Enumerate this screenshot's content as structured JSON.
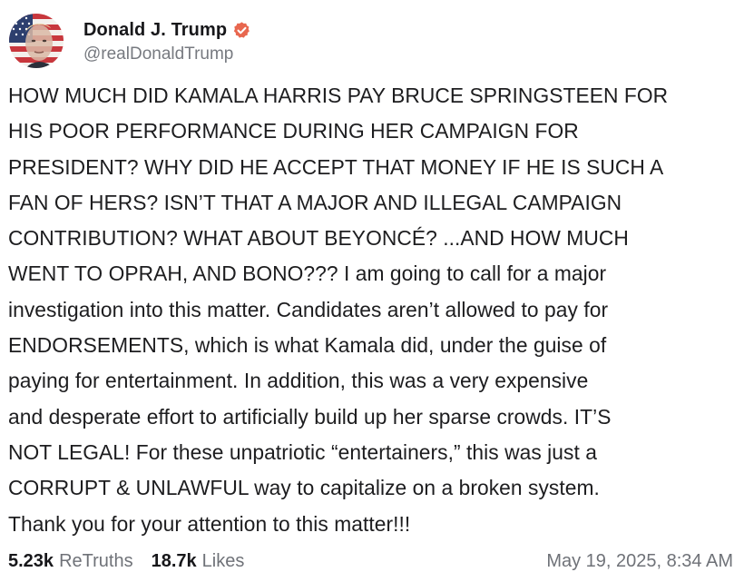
{
  "author": {
    "display_name": "Donald J. Trump",
    "handle": "@realDonaldTrump",
    "avatar_icon": "avatar-flag-portrait",
    "verified_icon": "verified-badge-icon",
    "verified_color": "#e8674f"
  },
  "post": {
    "lines": [
      "HOW MUCH DID KAMALA HARRIS PAY BRUCE SPRINGSTEEN FOR",
      "HIS POOR PERFORMANCE DURING HER CAMPAIGN FOR",
      "PRESIDENT? WHY DID HE ACCEPT THAT MONEY IF HE IS SUCH A",
      "FAN OF HERS? ISN’T THAT A MAJOR AND ILLEGAL CAMPAIGN",
      "CONTRIBUTION? WHAT ABOUT BEYONCÉ? ...AND HOW MUCH",
      "WENT TO OPRAH, AND BONO??? I am going to call for a major",
      "investigation into this matter. Candidates aren’t allowed to pay for",
      "ENDORSEMENTS, which is what Kamala did, under the guise of",
      "paying for entertainment. In addition, this was a very expensive",
      "and desperate effort to artificially build up her sparse crowds. IT’S",
      "NOT LEGAL! For these unpatriotic “entertainers,” this was just a",
      "CORRUPT & UNLAWFUL way to capitalize on a broken system.",
      "Thank you for your attention to this matter!!!"
    ]
  },
  "stats": {
    "retruths_count": "5.23k",
    "retruths_label": "ReTruths",
    "likes_count": "18.7k",
    "likes_label": "Likes"
  },
  "timestamp": "May 19, 2025, 8:34 AM"
}
